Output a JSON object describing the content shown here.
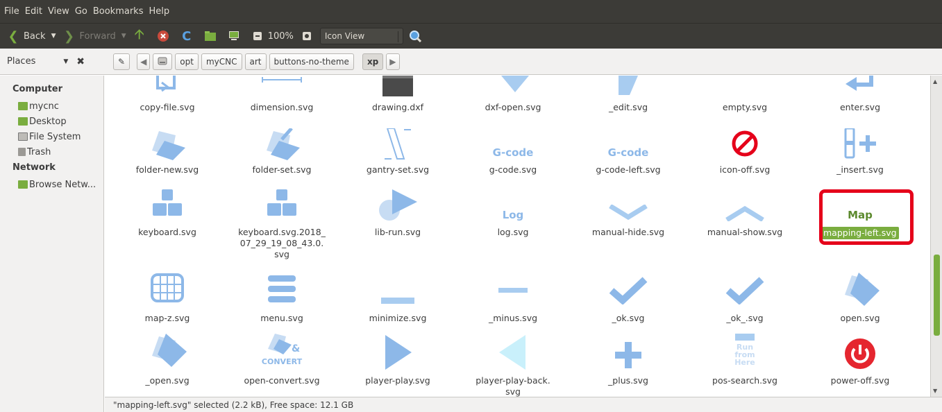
{
  "menu": [
    "File",
    "Edit",
    "View",
    "Go",
    "Bookmarks",
    "Help"
  ],
  "toolbar": {
    "back": "Back",
    "forward": "Forward",
    "zoom": "100%",
    "view": "Icon View"
  },
  "places": {
    "label": "Places"
  },
  "breadcrumbs": [
    "opt",
    "myCNC",
    "art",
    "buttons-no-theme",
    "xp"
  ],
  "sidebar": {
    "computer_heading": "Computer",
    "computer_items": [
      "mycnc",
      "Desktop",
      "File System",
      "Trash"
    ],
    "network_heading": "Network",
    "network_items": [
      "Browse Netw..."
    ]
  },
  "files": [
    {
      "name": "copy-file.svg"
    },
    {
      "name": "dimension.svg"
    },
    {
      "name": "drawing.dxf"
    },
    {
      "name": "dxf-open.svg"
    },
    {
      "name": "_edit.svg"
    },
    {
      "name": "empty.svg"
    },
    {
      "name": "enter.svg"
    },
    {
      "name": "folder-new.svg"
    },
    {
      "name": "folder-set.svg"
    },
    {
      "name": "gantry-set.svg"
    },
    {
      "name": "g-code.svg",
      "icon_text": "G-code"
    },
    {
      "name": "g-code-left.svg",
      "icon_text": "G-code"
    },
    {
      "name": "icon-off.svg"
    },
    {
      "name": "_insert.svg"
    },
    {
      "name": "keyboard.svg"
    },
    {
      "name": "keyboard.svg.2018_07_29_19_08_43.0.svg",
      "line1": "keyboard.svg.2018_",
      "line2": "07_29_19_08_43.0.",
      "line3": "svg"
    },
    {
      "name": "lib-run.svg"
    },
    {
      "name": "log.svg",
      "icon_text": "Log"
    },
    {
      "name": "manual-hide.svg"
    },
    {
      "name": "manual-show.svg"
    },
    {
      "name": "mapping-left.svg",
      "icon_text": "Map",
      "selected": true
    },
    {
      "name": "map-z.svg"
    },
    {
      "name": "menu.svg"
    },
    {
      "name": "minimize.svg"
    },
    {
      "name": "_minus.svg"
    },
    {
      "name": "_ok.svg"
    },
    {
      "name": "_ok_.svg"
    },
    {
      "name": "open.svg"
    },
    {
      "name": "_open.svg"
    },
    {
      "name": "open-convert.svg",
      "icon_text": "CONVERT"
    },
    {
      "name": "player-play.svg"
    },
    {
      "name": "player-play-back.svg",
      "line1": "player-play-back.",
      "line2": "svg"
    },
    {
      "name": "_plus.svg"
    },
    {
      "name": "pos-search.svg",
      "icon_text": "Run from Here"
    },
    {
      "name": "power-off.svg"
    }
  ],
  "status": "\"mapping-left.svg\" selected (2.2 kB), Free space: 12.1 GB",
  "colors": {
    "accent": "#7aad3f",
    "icon_blue": "#8db8e8",
    "highlight": "#e5001a",
    "chrome": "#3c3b37"
  }
}
